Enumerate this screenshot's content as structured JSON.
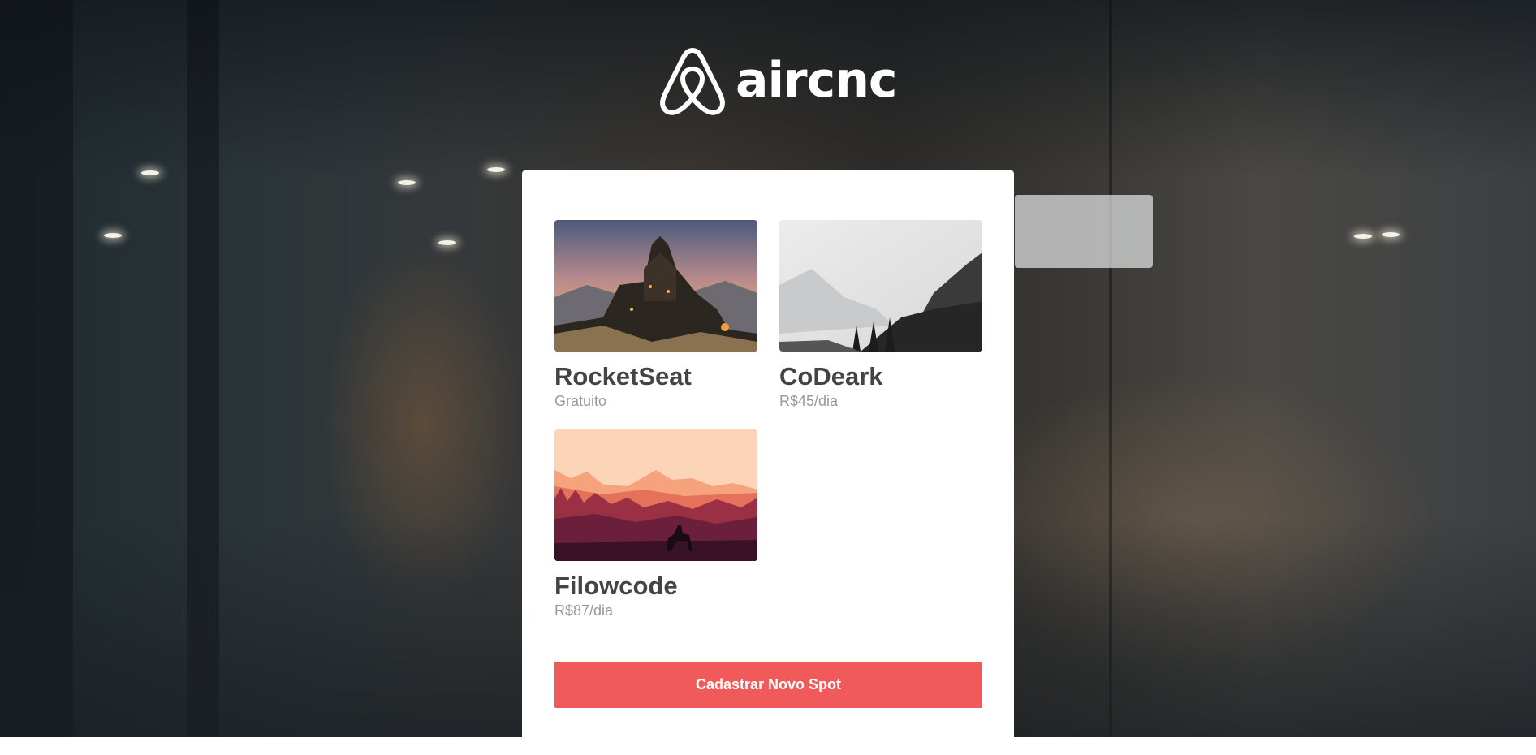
{
  "brand": {
    "name": "aircnc",
    "logo_icon": "airbnb-belo-icon",
    "accent": "#f05a5b"
  },
  "spots": [
    {
      "name": "RocketSeat",
      "price": "Gratuito",
      "thumb": "castle-landscape"
    },
    {
      "name": "CoDeark",
      "price": "R$45/dia",
      "thumb": "foggy-mountains"
    },
    {
      "name": "Filowcode",
      "price": "R$87/dia",
      "thumb": "sunset-rider"
    }
  ],
  "actions": {
    "new_spot_label": "Cadastrar Novo Spot"
  }
}
